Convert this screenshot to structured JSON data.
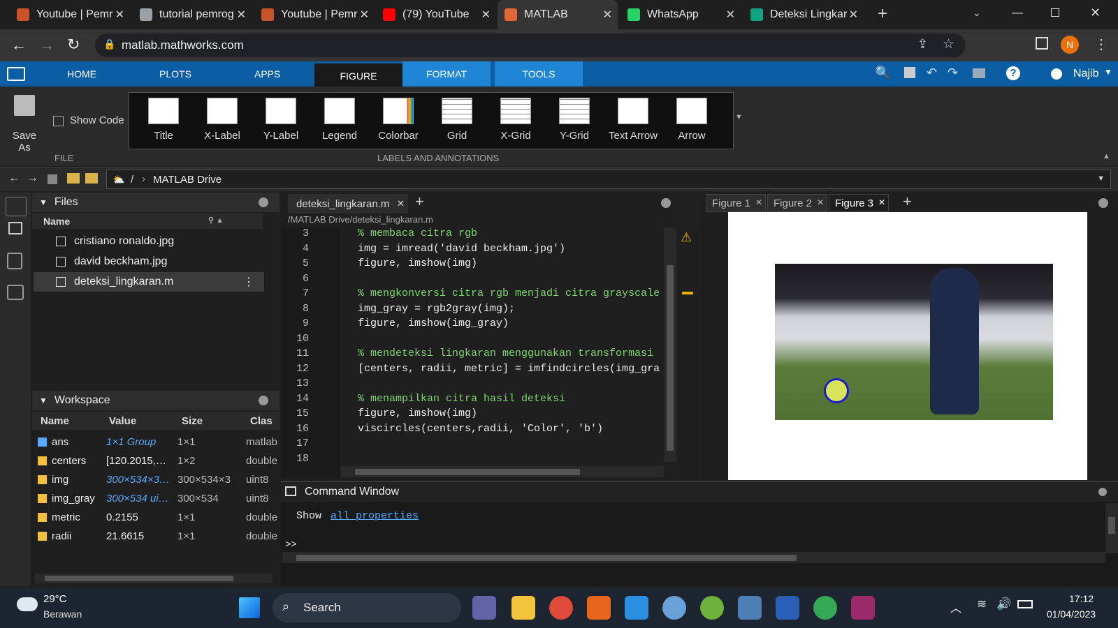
{
  "browser": {
    "tabs": [
      {
        "title": "Youtube | Pemr",
        "icon": "matlab-icon",
        "color": "#c9542a"
      },
      {
        "title": "tutorial pemrog",
        "icon": "globe-icon",
        "color": "#9aa0a6"
      },
      {
        "title": "Youtube | Pemr",
        "icon": "matlab-icon",
        "color": "#c9542a"
      },
      {
        "title": "(79) YouTube",
        "icon": "youtube-icon",
        "color": "#ff0000"
      },
      {
        "title": "MATLAB",
        "icon": "matlab-icon",
        "color": "#e16737"
      },
      {
        "title": "WhatsApp",
        "icon": "whatsapp-icon",
        "color": "#25d366"
      },
      {
        "title": "Deteksi Lingkar",
        "icon": "chatgpt-icon",
        "color": "#10a37f"
      }
    ],
    "url": "matlab.mathworks.com",
    "profile_initial": "N"
  },
  "ribbon": {
    "tabs": [
      "HOME",
      "PLOTS",
      "APPS",
      "FIGURE",
      "FORMAT",
      "TOOLS"
    ],
    "active_tab": "FIGURE",
    "user": "Najib",
    "save_as": "Save As",
    "show_code": "Show Code",
    "file_group": "FILE",
    "annotations_group": "LABELS AND ANNOTATIONS",
    "buttons": [
      "Title",
      "X-Label",
      "Y-Label",
      "Legend",
      "Colorbar",
      "Grid",
      "X-Grid",
      "Y-Grid",
      "Text Arrow",
      "Arrow"
    ]
  },
  "path": {
    "sep": "/",
    "folder": "MATLAB Drive"
  },
  "files": {
    "title": "Files",
    "col_name": "Name",
    "items": [
      "cristiano ronaldo.jpg",
      "david beckham.jpg",
      "deteksi_lingkaran.m"
    ],
    "selected": 2
  },
  "workspace": {
    "title": "Workspace",
    "columns": [
      "Name",
      "Value",
      "Size",
      "Clas"
    ],
    "rows": [
      {
        "name": "ans",
        "value": "1×1 Group",
        "size": "1×1",
        "class": "matlab"
      },
      {
        "name": "centers",
        "value": "[120.2015,…",
        "size": "1×2",
        "class": "double"
      },
      {
        "name": "img",
        "value": "300×534×3…",
        "size": "300×534×3",
        "class": "uint8"
      },
      {
        "name": "img_gray",
        "value": "300×534 ui…",
        "size": "300×534",
        "class": "uint8"
      },
      {
        "name": "metric",
        "value": "0.2155",
        "size": "1×1",
        "class": "double"
      },
      {
        "name": "radii",
        "value": "21.6615",
        "size": "1×1",
        "class": "double"
      }
    ]
  },
  "editor": {
    "tab": "deteksi_lingkaran.m",
    "path": "/MATLAB Drive/deteksi_lingkaran.m",
    "lines": [
      {
        "n": "3",
        "t": "% membaca citra rgb",
        "c": true
      },
      {
        "n": "4",
        "t": "img = imread('david beckham.jpg')",
        "c": false
      },
      {
        "n": "5",
        "t": "figure, imshow(img)",
        "c": false
      },
      {
        "n": "6",
        "t": "",
        "c": false
      },
      {
        "n": "7",
        "t": "% mengkonversi citra rgb menjadi citra grayscale",
        "c": true
      },
      {
        "n": "8",
        "t": "img_gray = rgb2gray(img);",
        "c": false
      },
      {
        "n": "9",
        "t": "figure, imshow(img_gray)",
        "c": false
      },
      {
        "n": "10",
        "t": "",
        "c": false
      },
      {
        "n": "11",
        "t": "% mendeteksi lingkaran menggunakan transformasi",
        "c": true
      },
      {
        "n": "12",
        "t": "[centers, radii, metric] = imfindcircles(img_gra",
        "c": false
      },
      {
        "n": "13",
        "t": "",
        "c": false
      },
      {
        "n": "14",
        "t": "% menampilkan citra hasil deteksi",
        "c": true
      },
      {
        "n": "15",
        "t": "figure, imshow(img)",
        "c": false
      },
      {
        "n": "16",
        "t": "viscircles(centers,radii, 'Color', 'b')",
        "c": false
      },
      {
        "n": "17",
        "t": "",
        "c": false
      },
      {
        "n": "18",
        "t": "",
        "c": false
      }
    ]
  },
  "figures": {
    "tabs": [
      "Figure 1",
      "Figure 2",
      "Figure 3"
    ],
    "active": 2
  },
  "command": {
    "title": "Command Window",
    "show": "Show",
    "link": "all properties",
    "prompt": ">>"
  },
  "taskbar": {
    "temp": "29°C",
    "weather": "Berawan",
    "search": "Search",
    "time": "17:12",
    "date": "01/04/2023"
  }
}
